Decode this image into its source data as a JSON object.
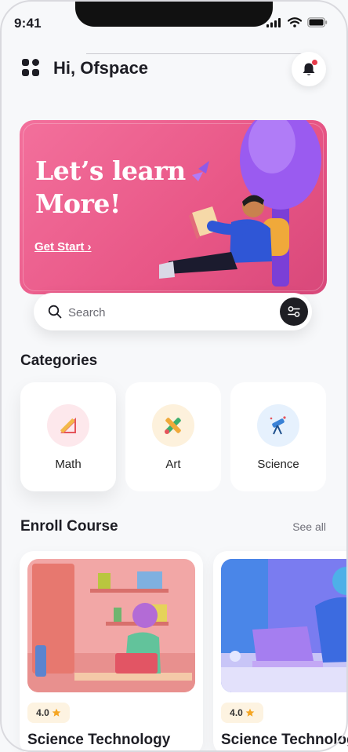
{
  "status": {
    "time": "9:41"
  },
  "header": {
    "greeting": "Hi, Ofspace"
  },
  "hero": {
    "line1": "Let’s learn",
    "line2": "More!",
    "cta": "Get Start",
    "cta_arrow": "›"
  },
  "search": {
    "placeholder": "Search"
  },
  "categories": {
    "title": "Categories",
    "items": [
      {
        "label": "Math",
        "icon": "ruler-triangle-icon"
      },
      {
        "label": "Art",
        "icon": "pencil-brush-icon"
      },
      {
        "label": "Science",
        "icon": "telescope-icon"
      }
    ]
  },
  "enroll": {
    "title": "Enroll Course",
    "see_all": "See all",
    "courses": [
      {
        "rating": "4.0",
        "title": "Science Technology"
      },
      {
        "rating": "4.0",
        "title": "Science Technology"
      }
    ]
  },
  "colors": {
    "accent": "#e85686",
    "notification": "#e63b4b",
    "star": "#f5a623"
  }
}
